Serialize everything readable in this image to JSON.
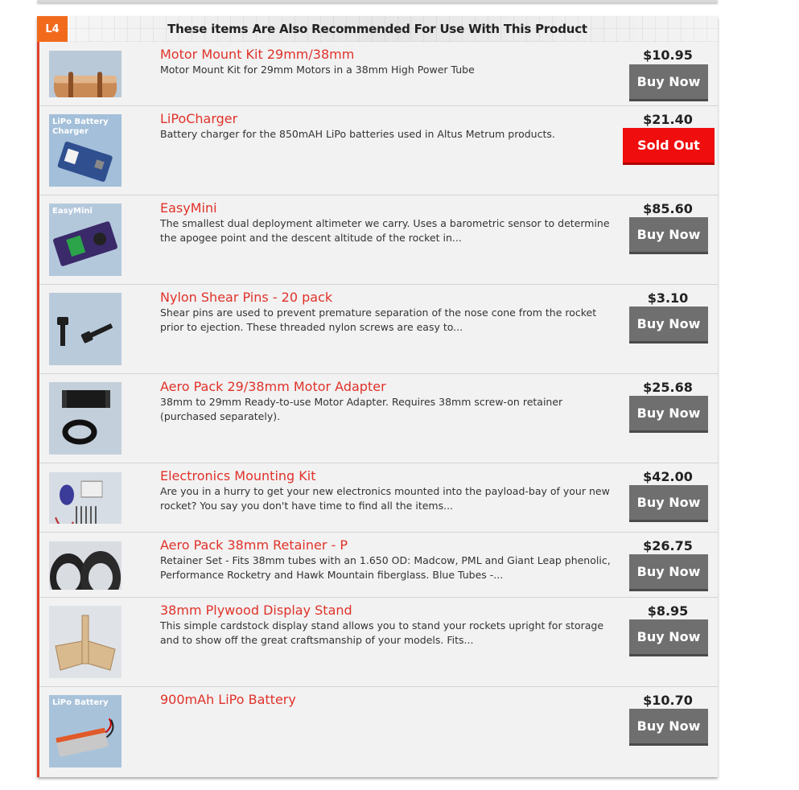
{
  "section": {
    "level_badge": "L4",
    "title": "These items Are Also Recommended For Use With This Product"
  },
  "items": [
    {
      "name": "Motor Mount Kit 29mm/38mm",
      "description": "Motor Mount Kit for 29mm Motors in a 38mm High Power Tube",
      "price": "$10.95",
      "button": "Buy Now",
      "image": "motor-mount-tube-image"
    },
    {
      "name": "LiPoCharger",
      "description": "Battery charger for the 850mAH LiPo batteries used in Altus Metrum products.",
      "price": "$21.40",
      "button": "Sold Out",
      "image": "lipo-charger-image",
      "image_caption": "LiPo Battery Charger"
    },
    {
      "name": "EasyMini",
      "description": "The smallest dual deployment altimeter we carry. Uses a barometric sensor to determine the apogee point and the descent altitude of the rocket in...",
      "price": "$85.60",
      "button": "Buy Now",
      "image": "easymini-board-image",
      "image_caption": "EasyMini"
    },
    {
      "name": "Nylon Shear Pins - 20 pack",
      "description": "Shear pins are used to prevent premature separation of the nose cone from the rocket prior to ejection. These threaded nylon screws are easy to...",
      "price": "$3.10",
      "button": "Buy Now",
      "image": "shear-pins-image"
    },
    {
      "name": "Aero Pack 29/38mm Motor Adapter",
      "description": "38mm to 29mm Ready-to-use Motor Adapter. Requires 38mm screw-on retainer (purchased separately).",
      "price": "$25.68",
      "button": "Buy Now",
      "image": "motor-adapter-image"
    },
    {
      "name": "Electronics Mounting Kit",
      "description": "Are you in a hurry to get your new electronics mounted into the payload-bay of your new rocket? You say you don't have time to find all the items...",
      "price": "$42.00",
      "button": "Buy Now",
      "image": "electronics-kit-image"
    },
    {
      "name": "Aero Pack 38mm Retainer - P",
      "description": "Retainer Set - Fits 38mm tubes with an 1.650 OD: Madcow, PML and Giant Leap phenolic, Performance Rocketry and Hawk Mountain fiberglass. Blue Tubes -...",
      "price": "$26.75",
      "button": "Buy Now",
      "image": "retainer-rings-image"
    },
    {
      "name": "38mm Plywood Display Stand",
      "description": "This simple cardstock display stand allows you to stand your rockets upright for storage and to show off the great craftsmanship of your models. Fits...",
      "price": "$8.95",
      "button": "Buy Now",
      "image": "display-stand-image"
    },
    {
      "name": "900mAh LiPo Battery",
      "description": "",
      "price": "$10.70",
      "button": "Buy Now",
      "image": "lipo-battery-image",
      "image_caption": "LiPo Battery"
    }
  ],
  "colors": {
    "accent": "#e2402a",
    "badge": "#f26b1d",
    "product_link": "#e0322a",
    "buy_button": "#6f6f6f",
    "sold_out_button": "#f00d0d"
  }
}
